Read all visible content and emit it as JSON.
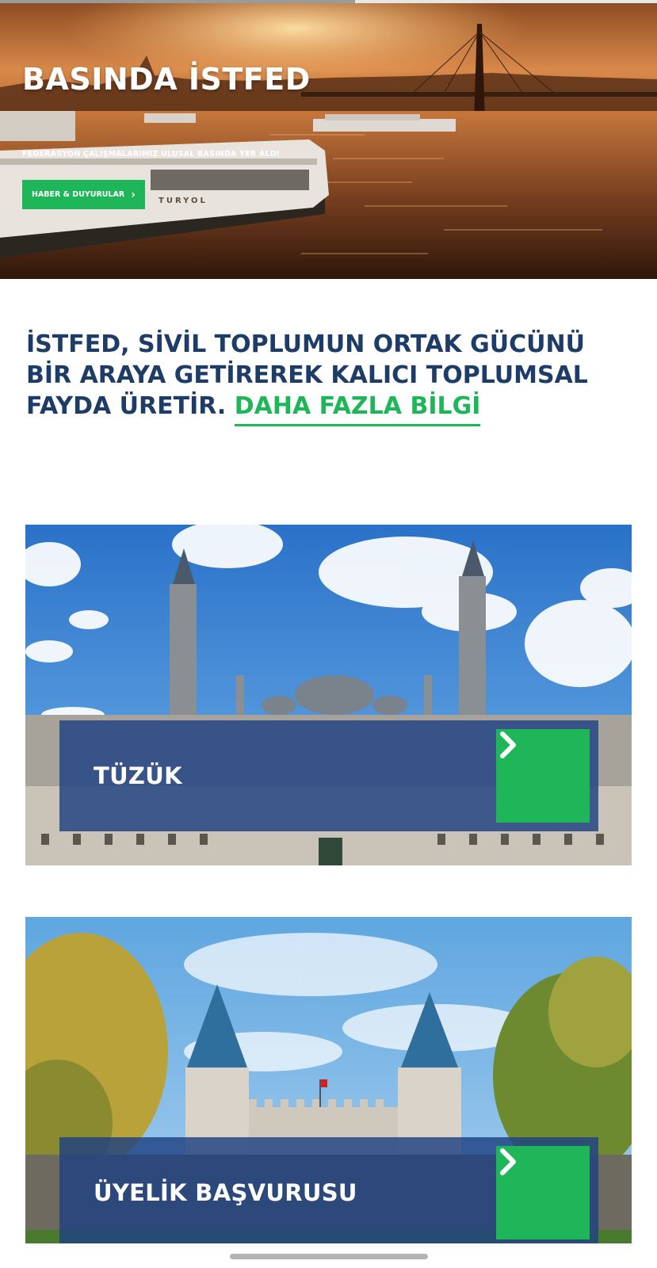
{
  "page": {
    "scroll_progress": 0.54
  },
  "hero": {
    "title": "BASINDA İSTFED",
    "subtitle": "FEDERASYON ÇALIŞMALARIMIZ ULUSAL BASINDA YER ALDI",
    "button_label": "HABER & DUYURULAR",
    "button_icon": "chevron-right-icon",
    "ferry_text": "TURYOL"
  },
  "statement": {
    "text": "İSTFED, SİVİL TOPLUMUN ORTAK GÜCÜNÜ BİR ARAYA GETİREREK KALICI TOPLUMSAL FAYDA ÜRETİR. ",
    "link_text": "DAHA FAZLA BİLGİ"
  },
  "cards": [
    {
      "label": "TÜZÜK",
      "icon": "chevron-right-icon"
    },
    {
      "label": "ÜYELİK BAŞVURUSU",
      "icon": "chevron-right-icon"
    }
  ],
  "colors": {
    "brand_navy": "#1d3c68",
    "accent_green": "#1fb65a",
    "overlay_blue": "#1e4282"
  }
}
